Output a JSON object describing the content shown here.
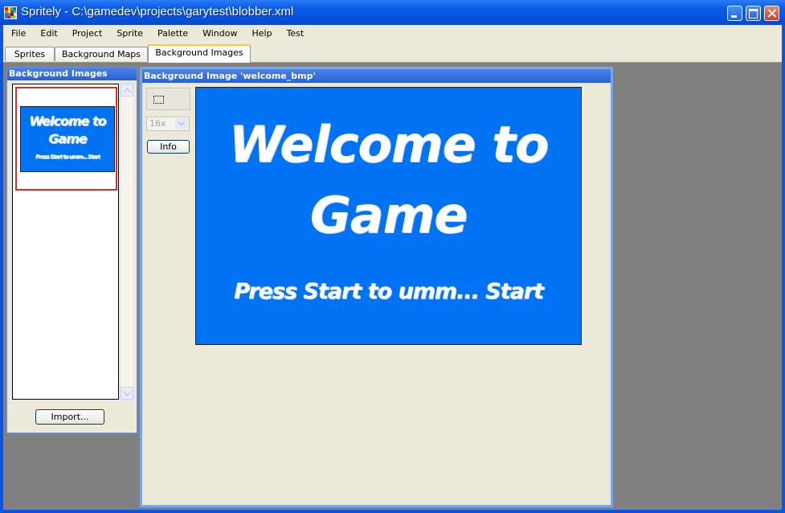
{
  "window": {
    "title": "Spritely - C:\\gamedev\\projects\\garytest\\blobber.xml",
    "titlebar_color": "#0553dc"
  },
  "menu": [
    "File",
    "Edit",
    "Project",
    "Sprite",
    "Palette",
    "Window",
    "Help",
    "Test"
  ],
  "tabs": [
    {
      "label": "Sprites",
      "active": false
    },
    {
      "label": "Background Maps",
      "active": false
    },
    {
      "label": "Background Images",
      "active": true
    }
  ],
  "left_panel": {
    "title": "Background Images",
    "import_label": "Import...",
    "selected_thumbnail": {
      "line1": "Welcome to",
      "line2": "Game",
      "subtitle": "Press Start to umm... Start"
    }
  },
  "main_panel": {
    "title": "Background Image 'welcome_bmp'",
    "zoom": "16x",
    "info_label": "Info",
    "tool_icon": "marquee-select-icon",
    "image": {
      "line1": "Welcome to",
      "line2": "Game",
      "subtitle": "Press Start to umm... Start",
      "background_color": "#0073f5"
    }
  },
  "colors": {
    "selection_border": "#d03030",
    "panel_header": "#2860d4",
    "workspace": "#808080"
  }
}
